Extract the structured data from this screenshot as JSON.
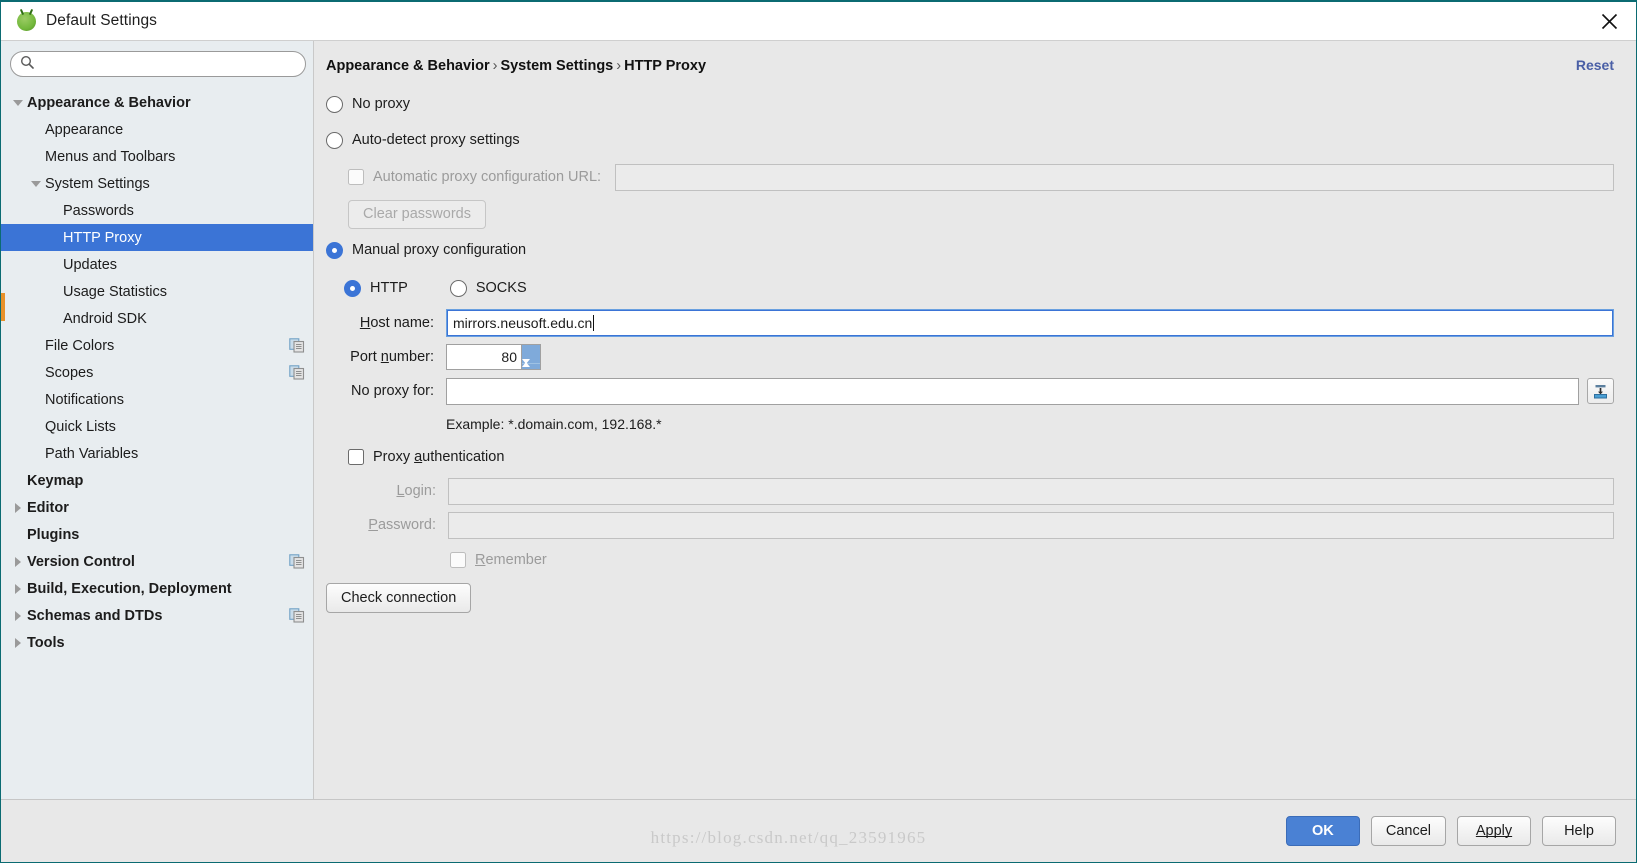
{
  "window": {
    "title": "Default Settings",
    "app_icon": "android-studio-icon",
    "close_icon": "close-icon"
  },
  "sidebar": {
    "search": {
      "value": "",
      "placeholder": "",
      "icon": "search-icon"
    },
    "items": [
      {
        "label": "Appearance & Behavior",
        "indent": 0,
        "bold": true,
        "twisty": "expanded",
        "selected": false,
        "copy": false
      },
      {
        "label": "Appearance",
        "indent": 1,
        "bold": false,
        "twisty": "none",
        "selected": false,
        "copy": false
      },
      {
        "label": "Menus and Toolbars",
        "indent": 1,
        "bold": false,
        "twisty": "none",
        "selected": false,
        "copy": false
      },
      {
        "label": "System Settings",
        "indent": 1,
        "bold": false,
        "twisty": "expanded",
        "selected": false,
        "copy": false
      },
      {
        "label": "Passwords",
        "indent": 2,
        "bold": false,
        "twisty": "none",
        "selected": false,
        "copy": false
      },
      {
        "label": "HTTP Proxy",
        "indent": 2,
        "bold": false,
        "twisty": "none",
        "selected": true,
        "copy": false
      },
      {
        "label": "Updates",
        "indent": 2,
        "bold": false,
        "twisty": "none",
        "selected": false,
        "copy": false
      },
      {
        "label": "Usage Statistics",
        "indent": 2,
        "bold": false,
        "twisty": "none",
        "selected": false,
        "copy": false
      },
      {
        "label": "Android SDK",
        "indent": 2,
        "bold": false,
        "twisty": "none",
        "selected": false,
        "copy": false
      },
      {
        "label": "File Colors",
        "indent": 1,
        "bold": false,
        "twisty": "none",
        "selected": false,
        "copy": true
      },
      {
        "label": "Scopes",
        "indent": 1,
        "bold": false,
        "twisty": "none",
        "selected": false,
        "copy": true
      },
      {
        "label": "Notifications",
        "indent": 1,
        "bold": false,
        "twisty": "none",
        "selected": false,
        "copy": false
      },
      {
        "label": "Quick Lists",
        "indent": 1,
        "bold": false,
        "twisty": "none",
        "selected": false,
        "copy": false
      },
      {
        "label": "Path Variables",
        "indent": 1,
        "bold": false,
        "twisty": "none",
        "selected": false,
        "copy": false
      },
      {
        "label": "Keymap",
        "indent": 0,
        "bold": true,
        "twisty": "none",
        "selected": false,
        "copy": false
      },
      {
        "label": "Editor",
        "indent": 0,
        "bold": true,
        "twisty": "collapsed",
        "selected": false,
        "copy": false
      },
      {
        "label": "Plugins",
        "indent": 0,
        "bold": true,
        "twisty": "none",
        "selected": false,
        "copy": false
      },
      {
        "label": "Version Control",
        "indent": 0,
        "bold": true,
        "twisty": "collapsed",
        "selected": false,
        "copy": true
      },
      {
        "label": "Build, Execution, Deployment",
        "indent": 0,
        "bold": true,
        "twisty": "collapsed",
        "selected": false,
        "copy": false
      },
      {
        "label": "Schemas and DTDs",
        "indent": 0,
        "bold": true,
        "twisty": "collapsed",
        "selected": false,
        "copy": true
      },
      {
        "label": "Tools",
        "indent": 0,
        "bold": true,
        "twisty": "collapsed",
        "selected": false,
        "copy": false
      }
    ]
  },
  "main": {
    "breadcrumb": {
      "part1": "Appearance & Behavior",
      "sep1": "›",
      "part2": "System Settings",
      "sep2": "›",
      "part3": "HTTP Proxy"
    },
    "reset_label": "Reset",
    "proxy_mode": "manual",
    "options": {
      "no_proxy_label": "No proxy",
      "auto_detect_label": "Auto-detect proxy settings",
      "manual_label": "Manual proxy configuration"
    },
    "auto_config": {
      "checkbox_label": "Automatic proxy configuration URL:",
      "url_value": "",
      "enabled": false,
      "clear_passwords_label": "Clear passwords"
    },
    "manual": {
      "protocol": "HTTP",
      "http_label": "HTTP",
      "socks_label": "SOCKS",
      "host_label_pre": "H",
      "host_label_post": "ost name:",
      "host_value": "mirrors.neusoft.edu.cn",
      "port_label_pre": "Port ",
      "port_label_mid": "n",
      "port_label_post": "umber:",
      "port_value": "80",
      "no_proxy_label": "No proxy for:",
      "no_proxy_value": "",
      "expand_icon": "expand-field-icon",
      "example_text": "Example: *.domain.com, 192.168.*"
    },
    "auth": {
      "checkbox_label_pre": "Proxy ",
      "checkbox_label_mid": "a",
      "checkbox_label_post": "uthentication",
      "checked": false,
      "login_label_pre": "L",
      "login_label_post": "ogin:",
      "login_value": "",
      "password_label_pre": "P",
      "password_label_post": "assword:",
      "password_value": "",
      "remember_label_pre": "R",
      "remember_label_post": "emember"
    },
    "check_connection_label": "Check connection"
  },
  "footer": {
    "buttons": [
      {
        "label": "OK",
        "style": "primary"
      },
      {
        "label": "Cancel",
        "style": "normal"
      },
      {
        "label": "Apply",
        "style": "normal",
        "mnemonic": "A"
      },
      {
        "label": "Help",
        "style": "normal"
      }
    ],
    "watermark": "https://blog.csdn.net/qq_23591965"
  },
  "colors": {
    "accent": "#3b74d6",
    "selection": "#3b74d6",
    "link": "#4a5fa6",
    "sidebar_bg": "#e8edf0",
    "panel_bg": "#e8e8e8",
    "window_border": "#0b6b72"
  }
}
